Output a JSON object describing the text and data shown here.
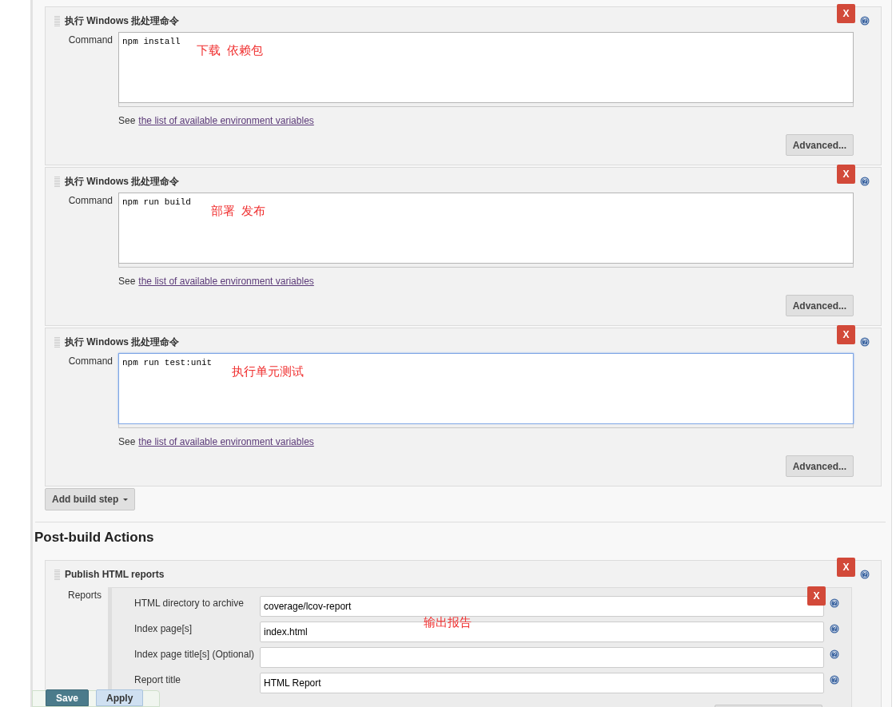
{
  "build_steps": [
    {
      "title": "执行 Windows 批处理命令",
      "field_label": "Command",
      "command": "npm install",
      "annotation": "下载  依赖包",
      "focused": false,
      "hint_prefix": "See",
      "hint_link": "the list of available environment variables",
      "advanced_button": "Advanced...",
      "delete_button": "X"
    },
    {
      "title": "执行 Windows 批处理命令",
      "field_label": "Command",
      "command": "npm run build",
      "annotation": "部署  发布",
      "focused": false,
      "hint_prefix": "See",
      "hint_link": "the list of available environment variables",
      "advanced_button": "Advanced...",
      "delete_button": "X"
    },
    {
      "title": "执行 Windows 批处理命令",
      "field_label": "Command",
      "command": "npm run test:unit",
      "annotation": "执行单元测试",
      "focused": true,
      "hint_prefix": "See",
      "hint_link": "the list of available environment variables",
      "advanced_button": "Advanced...",
      "delete_button": "X"
    }
  ],
  "add_build_step_button": "Add build step",
  "post_build": {
    "heading": "Post-build Actions",
    "actions": [
      {
        "title": "Publish HTML reports",
        "delete_button": "X",
        "reports_label": "Reports",
        "report": {
          "delete_button": "X",
          "annotation": "输出报告",
          "fields": [
            {
              "label": "HTML directory to archive",
              "value": "coverage/lcov-report"
            },
            {
              "label": "Index page[s]",
              "value": "index.html"
            },
            {
              "label": "Index page title[s] (Optional)"
            },
            {
              "label": "Report title",
              "value": "HTML Report"
            }
          ]
        }
      }
    ]
  },
  "footer_buttons": [
    {
      "label": "Save",
      "kind": "primary"
    },
    {
      "label": "Apply",
      "kind": "secondary"
    }
  ]
}
